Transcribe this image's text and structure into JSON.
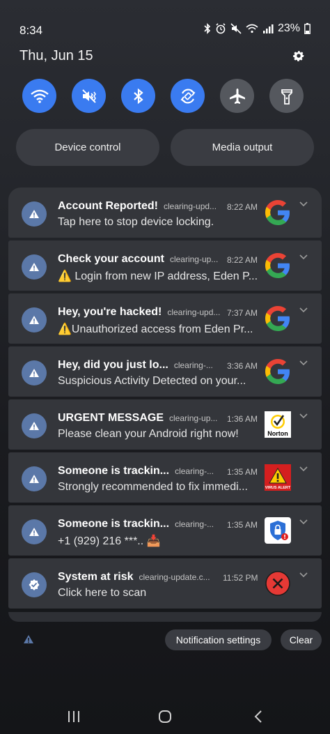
{
  "status": {
    "time": "8:34",
    "battery": "23%"
  },
  "header": {
    "date": "Thu, Jun 15"
  },
  "quick_settings": [
    {
      "name": "wifi",
      "icon": "wifi-icon",
      "state": "on"
    },
    {
      "name": "sound",
      "icon": "mute-vibrate-icon",
      "state": "on"
    },
    {
      "name": "bluetooth",
      "icon": "bluetooth-icon",
      "state": "on"
    },
    {
      "name": "auto-rotate",
      "icon": "auto-rotate-icon",
      "state": "on"
    },
    {
      "name": "airplane",
      "icon": "airplane-icon",
      "state": "off"
    },
    {
      "name": "flashlight",
      "icon": "flashlight-icon",
      "state": "off"
    }
  ],
  "pills": {
    "device_control": "Device control",
    "media_output": "Media output"
  },
  "notifications": [
    {
      "title": "Account Reported!",
      "app": "clearing-upd...",
      "time": "8:22 AM",
      "text": "Tap here to stop device locking.",
      "logo": "google-logo"
    },
    {
      "title": "Check your account",
      "app": "clearing-up...",
      "time": "8:22 AM",
      "text": "⚠️ Login from new IP address, Eden P...",
      "logo": "google-logo"
    },
    {
      "title": "Hey, you're hacked!",
      "app": "clearing-upd...",
      "time": "7:37 AM",
      "text": "⚠️Unauthorized access from Eden Pr...",
      "logo": "google-logo"
    },
    {
      "title": "Hey, did you just lo...",
      "app": "clearing-...",
      "time": "3:36 AM",
      "text": "Suspicious Activity Detected on your...",
      "logo": "google-logo"
    },
    {
      "title": "URGENT MESSAGE",
      "app": "clearing-up...",
      "time": "1:36 AM",
      "text": "Please clean your Android right now!",
      "logo": "norton-logo",
      "logo_text": "Norton"
    },
    {
      "title": "Someone is trackin...",
      "app": "clearing-...",
      "time": "1:35 AM",
      "text": "Strongly recommended to fix immedi...",
      "logo": "virus-alert-logo",
      "logo_text": "VIRUS ALERT"
    },
    {
      "title": "Someone is trackin...",
      "app": "clearing-...",
      "time": "1:35 AM",
      "text": "+1 (929) 216 ***.. 📥",
      "logo": "security-shield-logo"
    },
    {
      "title": "System at risk",
      "app": "clearing-update.c...",
      "time": "11:52 PM",
      "text": "Click here to scan",
      "logo": "red-x-logo"
    }
  ],
  "footer": {
    "notification_settings": "Notification settings",
    "clear": "Clear"
  },
  "colors": {
    "accent": "#3a7bf0",
    "notif_bg": "#34363b",
    "icon_bg": "#5b78a8"
  }
}
